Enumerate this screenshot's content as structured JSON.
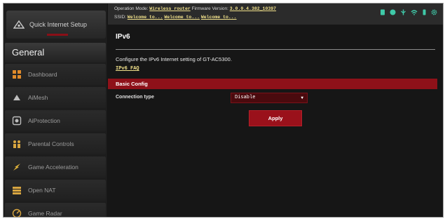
{
  "sidebar": {
    "quick_setup_label": "Quick Internet Setup",
    "section_title": "General",
    "items": [
      {
        "label": "Dashboard",
        "icon": "dashboard-icon"
      },
      {
        "label": "AiMesh",
        "icon": "aimesh-icon"
      },
      {
        "label": "AiProtection",
        "icon": "aiprotection-icon"
      },
      {
        "label": "Parental Controls",
        "icon": "parental-controls-icon"
      },
      {
        "label": "Game Acceleration",
        "icon": "game-acceleration-icon"
      },
      {
        "label": "Open NAT",
        "icon": "open-nat-icon"
      },
      {
        "label": "Game Radar",
        "icon": "game-radar-icon"
      }
    ]
  },
  "topbar": {
    "operation_mode_label": "Operation Mode:",
    "operation_mode_value": "Wireless router",
    "firmware_label": "Firmware Version:",
    "firmware_value": "3.0.0.4.382_10397",
    "ssid_label": "SSID:",
    "ssids": [
      "Welcome to...",
      "Welcome to...",
      "Welcome to..."
    ]
  },
  "status_icons": [
    "wan-status-icon",
    "globe-icon",
    "usb-icon",
    "wifi-icon",
    "user-icon",
    "gear-icon"
  ],
  "colors": {
    "accent": "#8e1119",
    "link": "#f0e08a"
  },
  "page": {
    "title": "IPv6",
    "description": "Configure the IPv6 Internet setting of GT-AC5300.",
    "faq_link": "IPv6 FAQ",
    "section_header": "Basic Config",
    "connection_type_label": "Connection type",
    "connection_type_value": "Disable",
    "apply_label": "Apply"
  }
}
